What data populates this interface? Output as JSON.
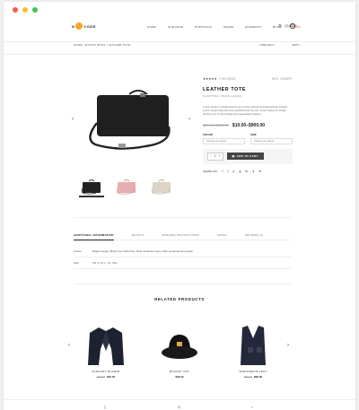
{
  "colors": {
    "dot_red": "#f25b4f",
    "dot_yellow": "#f7bd2d",
    "dot_green": "#3bc64a",
    "accent": "#e0663f",
    "logo": "#f6a623"
  },
  "header": {
    "logo_left": "N",
    "logo_right": "CODE",
    "nav": [
      "HOME",
      "OUR PAGE",
      "PORTFOLIO",
      "PAGES",
      "ELEMENTS",
      "BLOG",
      "SHOP"
    ],
    "active_index": 6,
    "cart": "(0) ITEM"
  },
  "breadcrumb": "HOME  /  ETHNIC BAGS  /  LEATHER TOTE",
  "pager": {
    "prev": "‹  PREVIOUS",
    "next": "NEXT  ›"
  },
  "product": {
    "stars": "★★★★★",
    "review_count": "2 REVIEWS",
    "sku": "SKU: 23948FF",
    "title": "LEATHER TOTE",
    "category": "SHOPPING, BAGS LARGE",
    "description": "Lorem Ipsum is simply dummy text of the printing and typesetting industry. Lorem Ipsum has been the standard dummy text. Lorem Ipsum is simply dummy text of the printing and typesetting industry.",
    "old_price": "$25.00–$950.00",
    "new_price": "$10.00–$900.00",
    "color_label": "COLOR",
    "size_label": "SIZE",
    "color_placeholder": "Choose an option...",
    "size_placeholder": "Choose an option...",
    "qty": "1",
    "add_to_cart": "ADD TO CART",
    "share_label": "SHARE ON:"
  },
  "tabs": [
    "ADDITIONAL INFORMATION",
    "DETAILS",
    "WASHING INSTRUCTIONS",
    "SIZING",
    "REVIEWS (2)"
  ],
  "attributes": [
    {
      "k": "Colors",
      "v": "Bright orange, Bright red, Dark blue, Dark moderate cyan, Dark moderate lime green"
    },
    {
      "k": "Size",
      "v": "XS, S, M, L, XL, XXL"
    }
  ],
  "related": {
    "title": "RELATED PRODUCTS",
    "items": [
      {
        "name": "ELEGANT BLAZER",
        "old": "$50.00",
        "new": "$40.00"
      },
      {
        "name": "BUCKET HAT",
        "old": "",
        "new": "$90.00"
      },
      {
        "name": "WORKWEAR VEST",
        "old": "$80.00",
        "new": "$90.00"
      }
    ]
  }
}
